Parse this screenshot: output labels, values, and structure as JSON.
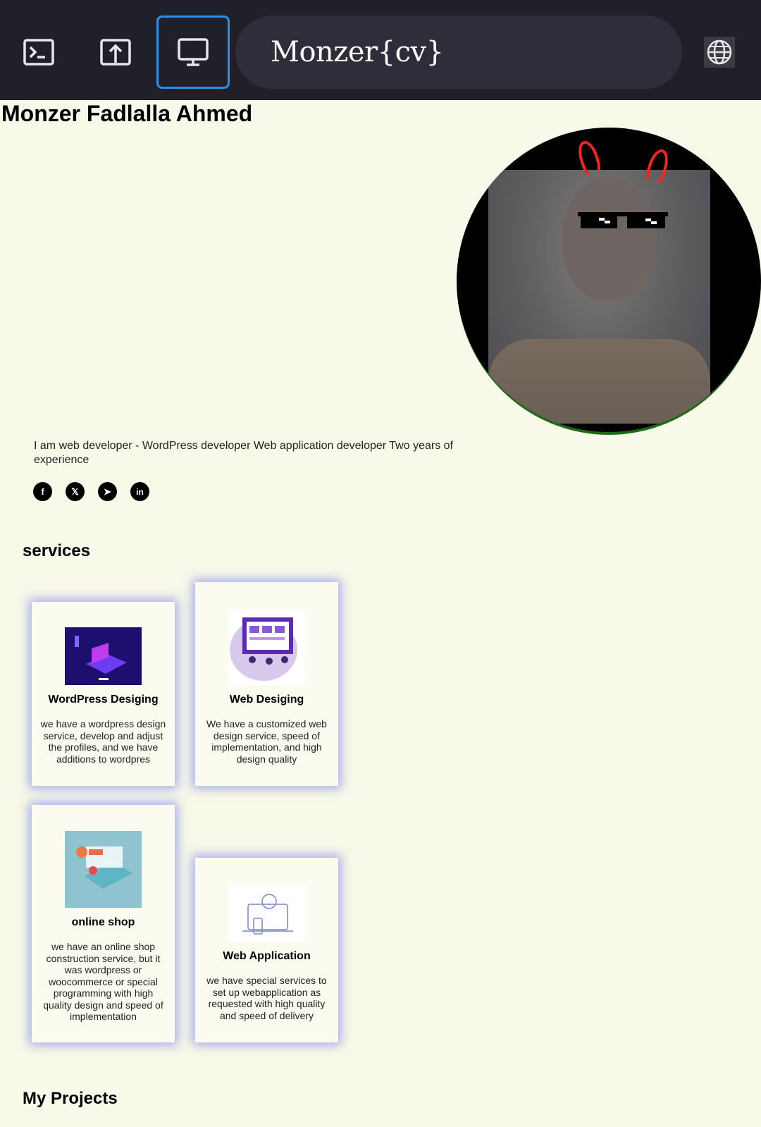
{
  "app": {
    "brand": "Monzer{cv}"
  },
  "profile": {
    "name": "Monzer Fadlalla Ahmed",
    "intro": "I am web developer - WordPress developer Web application developer Two years of experience",
    "socials": [
      {
        "name": "facebook",
        "glyph": "f"
      },
      {
        "name": "x",
        "glyph": "𝕏"
      },
      {
        "name": "telegram",
        "glyph": "➤"
      },
      {
        "name": "linkedin",
        "glyph": "in"
      }
    ]
  },
  "services": {
    "title": "services",
    "items": [
      {
        "title": "WordPress Desiging",
        "text": "we have a wordpress design service, develop and adjust the profiles, and we have additions to wordpres"
      },
      {
        "title": "Web Desiging",
        "text": "We have a customized web design service, speed of implementation, and high design quality"
      },
      {
        "title": "online shop",
        "text": "we have an online shop construction service, but it was wordpress or woocommerce or special programming with high quality design and speed of implementation"
      },
      {
        "title": "Web Application",
        "text": "we have special services to set up webapplication as requested with high quality and speed of delivery"
      }
    ]
  },
  "projects": {
    "title": "My Projects"
  },
  "colors": {
    "topbar": "#1f2029",
    "page_bg": "#f8f9e8",
    "active_border": "#2f8fe8",
    "card_glow": "#626eeb"
  },
  "icons": {
    "toolbar": [
      "terminal-icon",
      "upload-icon",
      "monitor-icon"
    ],
    "language": "globe-icon"
  }
}
